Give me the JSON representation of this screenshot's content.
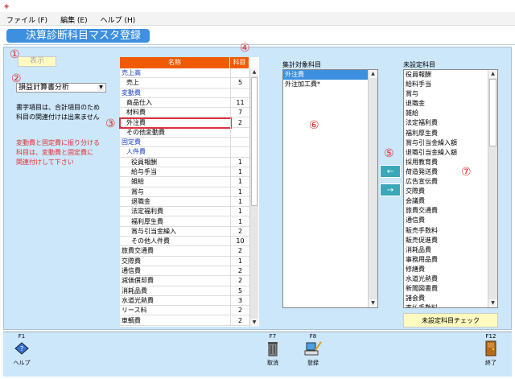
{
  "menu": [
    "ファイル (F)",
    "編集 (E)",
    "ヘルプ (H)"
  ],
  "page_title": "決算診断科目マスタ登録",
  "markers": [
    "①",
    "②",
    "③",
    "④",
    "⑤",
    "⑥",
    "⑦"
  ],
  "show_button": "表示",
  "dropdown_value": "損益計算書分析",
  "note1": [
    "書字項目は、合計項目のため",
    "科目の関連付けは出来ません"
  ],
  "note2": [
    "変動費と固定費に振り分ける",
    "科目は、変動費と固定費に",
    "関連付けして下さい"
  ],
  "table": {
    "headers": [
      "名称",
      "科目数"
    ],
    "rows": [
      {
        "name": "売上高",
        "count": "",
        "type": "cat",
        "indent": 0
      },
      {
        "name": "売上",
        "count": "5",
        "indent": 1
      },
      {
        "name": "変動費",
        "count": "",
        "type": "cat",
        "indent": 0
      },
      {
        "name": "商品仕入",
        "count": "11",
        "indent": 1
      },
      {
        "name": "材料費",
        "count": "7",
        "indent": 1
      },
      {
        "name": "外注費",
        "count": "2",
        "indent": 1,
        "selected": true
      },
      {
        "name": "その他変動費",
        "count": "",
        "indent": 1
      },
      {
        "name": "固定費",
        "count": "",
        "type": "cat",
        "indent": 0
      },
      {
        "name": "人件費",
        "count": "",
        "type": "cat",
        "indent": 1
      },
      {
        "name": "役員報酬",
        "count": "1",
        "indent": 2
      },
      {
        "name": "給与手当",
        "count": "1",
        "indent": 2
      },
      {
        "name": "雑給",
        "count": "1",
        "indent": 2
      },
      {
        "name": "賞与",
        "count": "1",
        "indent": 2
      },
      {
        "name": "退職金",
        "count": "1",
        "indent": 2
      },
      {
        "name": "法定福利費",
        "count": "1",
        "indent": 2
      },
      {
        "name": "福利厚生費",
        "count": "1",
        "indent": 2
      },
      {
        "name": "賞与引当金繰入",
        "count": "2",
        "indent": 2
      },
      {
        "name": "その他人件費",
        "count": "10",
        "indent": 2
      },
      {
        "name": "旅費交通費",
        "count": "2",
        "indent": 0
      },
      {
        "name": "交際費",
        "count": "1",
        "indent": 0
      },
      {
        "name": "通信費",
        "count": "2",
        "indent": 0
      },
      {
        "name": "減価償却費",
        "count": "2",
        "indent": 0
      },
      {
        "name": "消耗品費",
        "count": "5",
        "indent": 0
      },
      {
        "name": "水道光熱費",
        "count": "3",
        "indent": 0
      },
      {
        "name": "リース料",
        "count": "2",
        "indent": 0
      },
      {
        "name": "車輌費",
        "count": "2",
        "indent": 0
      }
    ]
  },
  "target_list": {
    "label": "集計対象科目",
    "items": [
      "外注費",
      "外注加工費*"
    ]
  },
  "unset_list": {
    "label": "未設定科目",
    "items": [
      "役員報酬",
      "給料手当",
      "賞与",
      "退職金",
      "雑給",
      "法定福利費",
      "福利厚生費",
      "賞与引当金繰入額",
      "退職引当金繰入額",
      "採用教育費",
      "荷造発送費",
      "広告宣伝費",
      "交際費",
      "会議費",
      "旅費交通費",
      "通信費",
      "販売手数料",
      "販売促進費",
      "消耗品費",
      "事務用品費",
      "修繕費",
      "水道光熱費",
      "新聞図書費",
      "諸会費",
      "支払手数料"
    ]
  },
  "move_left": "←",
  "move_right": "→",
  "check_button": "未設定科目チェック",
  "fkeys": [
    {
      "key": "F1",
      "label": "ヘルプ",
      "icon": "help-book-icon"
    },
    {
      "key": "F7",
      "label": "取消",
      "icon": "trash-icon"
    },
    {
      "key": "F8",
      "label": "登録",
      "icon": "register-pc-icon"
    },
    {
      "key": "F12",
      "label": "終了",
      "icon": "exit-door-icon"
    }
  ]
}
